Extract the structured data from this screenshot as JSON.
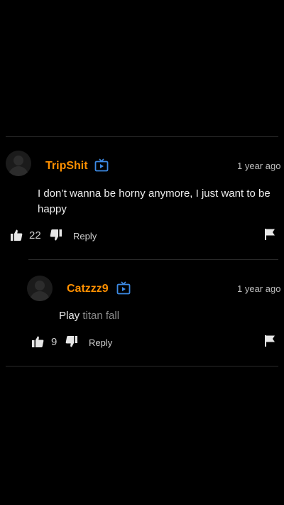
{
  "comments": [
    {
      "username": "TripShit",
      "timestamp": "1 year ago",
      "text": "I don’t wanna be horny anymore, I just want to be happy",
      "likes": "22",
      "reply_label": "Reply"
    }
  ],
  "replies": [
    {
      "username": "Catzzz9",
      "timestamp": "1 year ago",
      "text_part1": "Play ",
      "text_part2": "titan fall",
      "likes": "9",
      "reply_label": "Reply"
    }
  ],
  "colors": {
    "username": "#ff9000",
    "badge": "#3d8be6",
    "background": "#000000"
  },
  "icons": [
    "tv-badge-icon",
    "thumbs-up-icon",
    "thumbs-down-icon",
    "flag-icon"
  ]
}
